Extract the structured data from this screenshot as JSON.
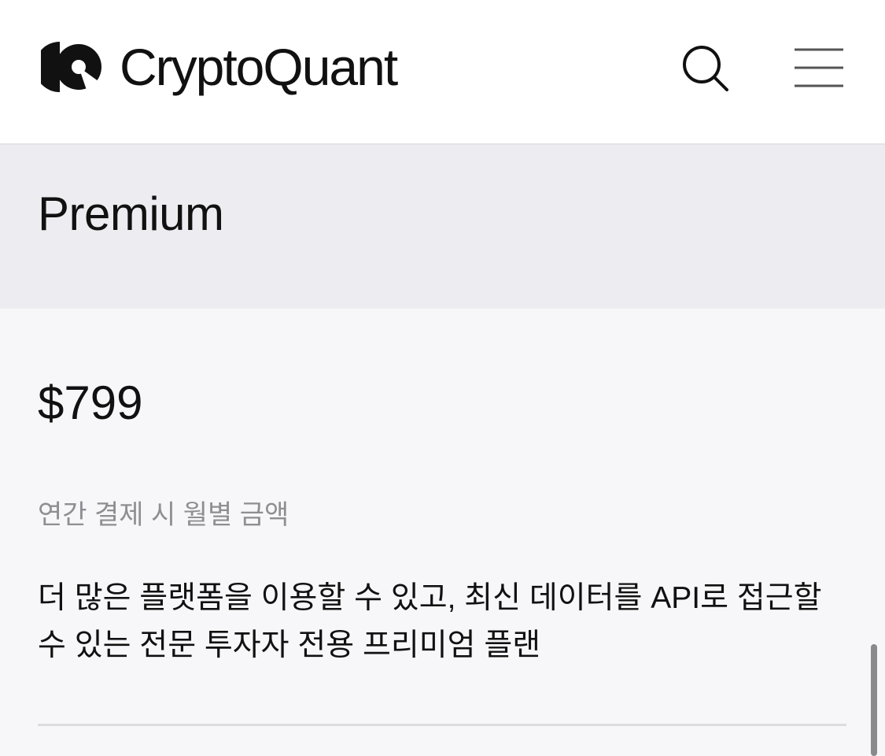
{
  "header": {
    "brand_name": "CryptoQuant",
    "logo_icon": "cryptoquant-logo-icon",
    "search_icon": "search-icon",
    "menu_icon": "hamburger-menu-icon"
  },
  "plan": {
    "name": "Premium",
    "price": "$799",
    "price_note": "연간 결제 시 월별 금액",
    "description": "더 많은 플랫폼을 이용할 수 있고, 최신 데이터를 API로 접근할 수 있는 전문 투자자 전용 프리미엄 플랜"
  },
  "colors": {
    "header_bg": "#ffffff",
    "band_bg": "#ededf1",
    "page_bg": "#f7f7f9",
    "muted_text": "#8e8e93"
  }
}
